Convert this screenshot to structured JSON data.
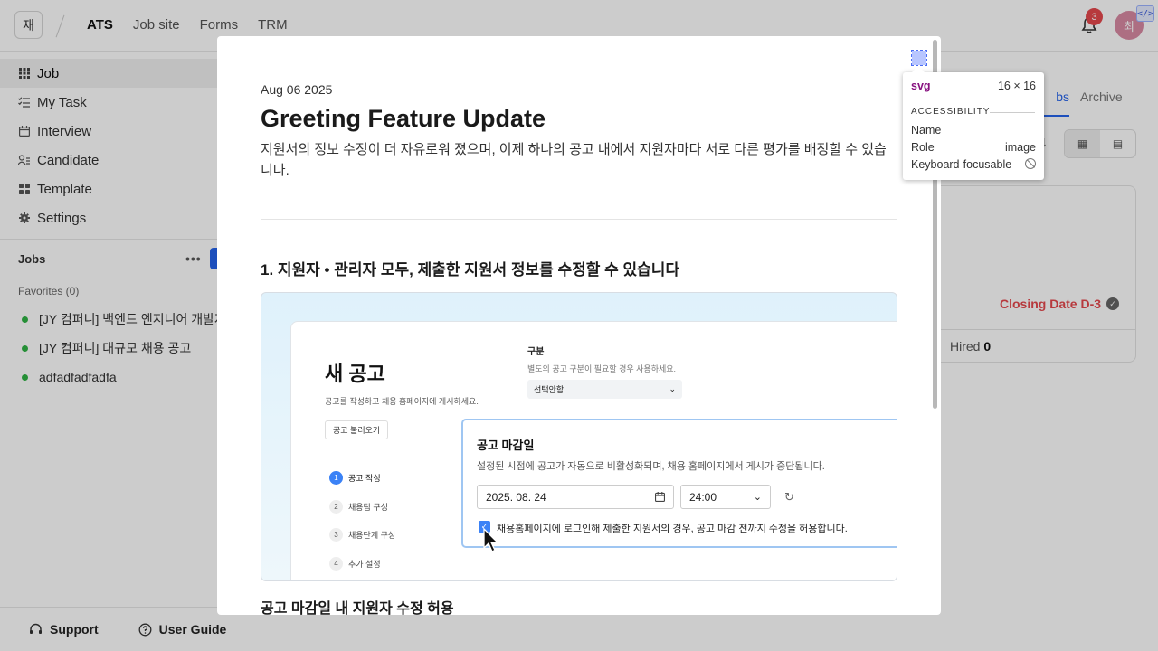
{
  "app": {
    "workspace_initial": "재",
    "nav": [
      "ATS",
      "Job site",
      "Forms",
      "TRM"
    ],
    "notification_count": "3",
    "avatar_initial": "최"
  },
  "sidebar": {
    "items": [
      {
        "label": "Job",
        "icon": "grid-icon"
      },
      {
        "label": "My Task",
        "icon": "checklist-icon"
      },
      {
        "label": "Interview",
        "icon": "calendar-icon"
      },
      {
        "label": "Candidate",
        "icon": "users-icon"
      },
      {
        "label": "Template",
        "icon": "template-icon"
      },
      {
        "label": "Settings",
        "icon": "gear-icon"
      }
    ],
    "jobs_label": "Jobs",
    "favorites_label": "Favorites (0)",
    "jobs": [
      "[JY 컴퍼니] 백엔드 엔지니어 개발자",
      "[JY 컴퍼니] 대규모 채용 공고",
      "adfadfadfadfa"
    ],
    "support_label": "Support",
    "guide_label": "User Guide"
  },
  "main": {
    "tab_partial": "bs",
    "tab_archive": "Archive",
    "closing_text": "Closing Date D-3",
    "hired_label": "Hired",
    "hired_count": "0"
  },
  "modal": {
    "date": "Aug 06 2025",
    "title": "Greeting Feature Update",
    "summary": "지원서의 정보 수정이 더 자유로워 졌으며, 이제 하나의 공고 내에서 지원자마다 서로 다른 평가를 배정할 수 있습니다.",
    "section1_title": "1. 지원자 • 관리자 모두, 제출한 지원서 정보를 수정할 수 있습니다",
    "subsection_title": "공고 마감일 내 지원자 수정 허용",
    "screenshot": {
      "page_title": "새 공고",
      "page_sub": "공고를 작성하고 채용 홈페이지에 게시하세요.",
      "load_button": "공고 불러오기",
      "steps": [
        {
          "num": "1",
          "label": "공고 작성"
        },
        {
          "num": "2",
          "label": "채용팀 구성"
        },
        {
          "num": "3",
          "label": "채용단계 구성"
        },
        {
          "num": "4",
          "label": "추가 설정"
        }
      ],
      "category_label": "구분",
      "category_help": "별도의 공고 구분이 필요할 경우 사용하세요.",
      "category_value": "선택안함",
      "deadline_title": "공고 마감일",
      "deadline_help": "설정된 시점에 공고가 자동으로 비활성화되며, 채용 홈페이지에서 게시가 중단됩니다.",
      "deadline_date": "2025. 08. 24",
      "deadline_time": "24:00",
      "allow_edit_label": "채용홈페이지에 로그인해 제출한 지원서의 경우, 공고 마감 전까지 수정을 허용합니다."
    }
  },
  "tooltip": {
    "tag": "svg",
    "size": "16 × 16",
    "section": "ACCESSIBILITY",
    "name_label": "Name",
    "role_label": "Role",
    "role_value": "image",
    "keyboard_label": "Keyboard-focusable"
  },
  "colors": {
    "accent": "#2563eb",
    "danger": "#e5484d",
    "success": "#2fb344",
    "devtools_tag": "#881280"
  }
}
